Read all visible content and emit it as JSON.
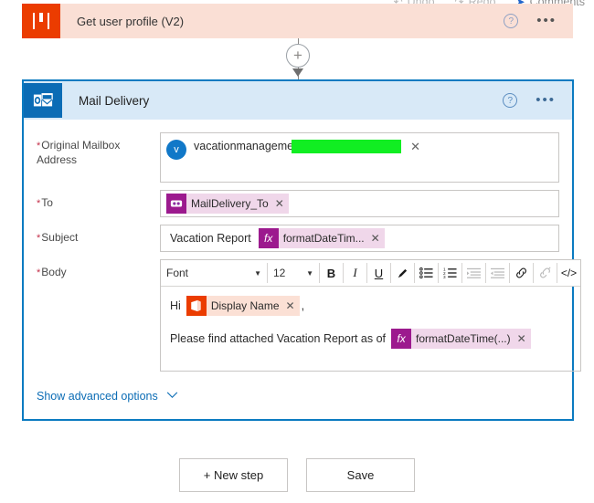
{
  "topbar": {
    "items": [
      {
        "label": "Undo",
        "icon": "undo-icon",
        "glyph": "↶"
      },
      {
        "label": "Redo",
        "icon": "redo-icon",
        "glyph": "↷"
      },
      {
        "label": "Comments",
        "icon": "comments-icon",
        "glyph": "➤"
      }
    ]
  },
  "previous_action": {
    "title": "Get user profile (V2)",
    "icon": "office365-users-icon",
    "help_label": "?",
    "menu_label": "•••",
    "accent_color": "#eb3c00",
    "background_color": "#fadfd5"
  },
  "connector": {
    "add_label": "+",
    "name": "insert-step-button"
  },
  "card": {
    "title": "Mail Delivery",
    "icon": "outlook-icon",
    "help_label": "?",
    "menu_label": "•••",
    "accent_color": "#0b7bc1",
    "header_color": "#d8e9f7"
  },
  "fields": {
    "mailbox": {
      "label": "Original Mailbox Address",
      "required": true,
      "avatar_initial": "v",
      "value": "vacationmanageme",
      "redacted": true,
      "clear_label": "✕"
    },
    "to": {
      "label": "To",
      "required": true,
      "token_label": "MailDelivery_To",
      "token_icon": "variable-icon",
      "clear_label": "✕"
    },
    "subject": {
      "label": "Subject",
      "required": true,
      "plain_text": "Vacation Report",
      "token_label": "formatDateTim...",
      "token_icon": "fx-icon",
      "token_icon_label": "fx",
      "clear_label": "✕"
    },
    "body": {
      "label": "Body",
      "required": true,
      "toolbar": {
        "font_name": "Font",
        "font_size": "12",
        "bold": "B",
        "italic": "I",
        "underline": "U",
        "text_color": "✎",
        "bulleted_list": "☰",
        "numbered_list": "☷",
        "indent": "→≡",
        "outdent": "←≡",
        "link": "ὑ7",
        "unlink": "⛓",
        "code_view": "</>"
      },
      "lines": [
        {
          "prefix": "Hi",
          "token_label": "Display Name",
          "token_icon": "office365-icon",
          "suffix": ",",
          "clear_label": "✕"
        },
        {
          "prefix": "Please find attached Vacation Report as of",
          "token_label": "formatDateTime(...)",
          "token_icon": "fx-icon",
          "token_icon_label": "fx",
          "suffix": "",
          "clear_label": "✕"
        }
      ]
    }
  },
  "advanced_options": {
    "label": "Show advanced options",
    "chevron": "⌄"
  },
  "footer": {
    "new_step_label": "+ New step",
    "save_label": "Save"
  }
}
